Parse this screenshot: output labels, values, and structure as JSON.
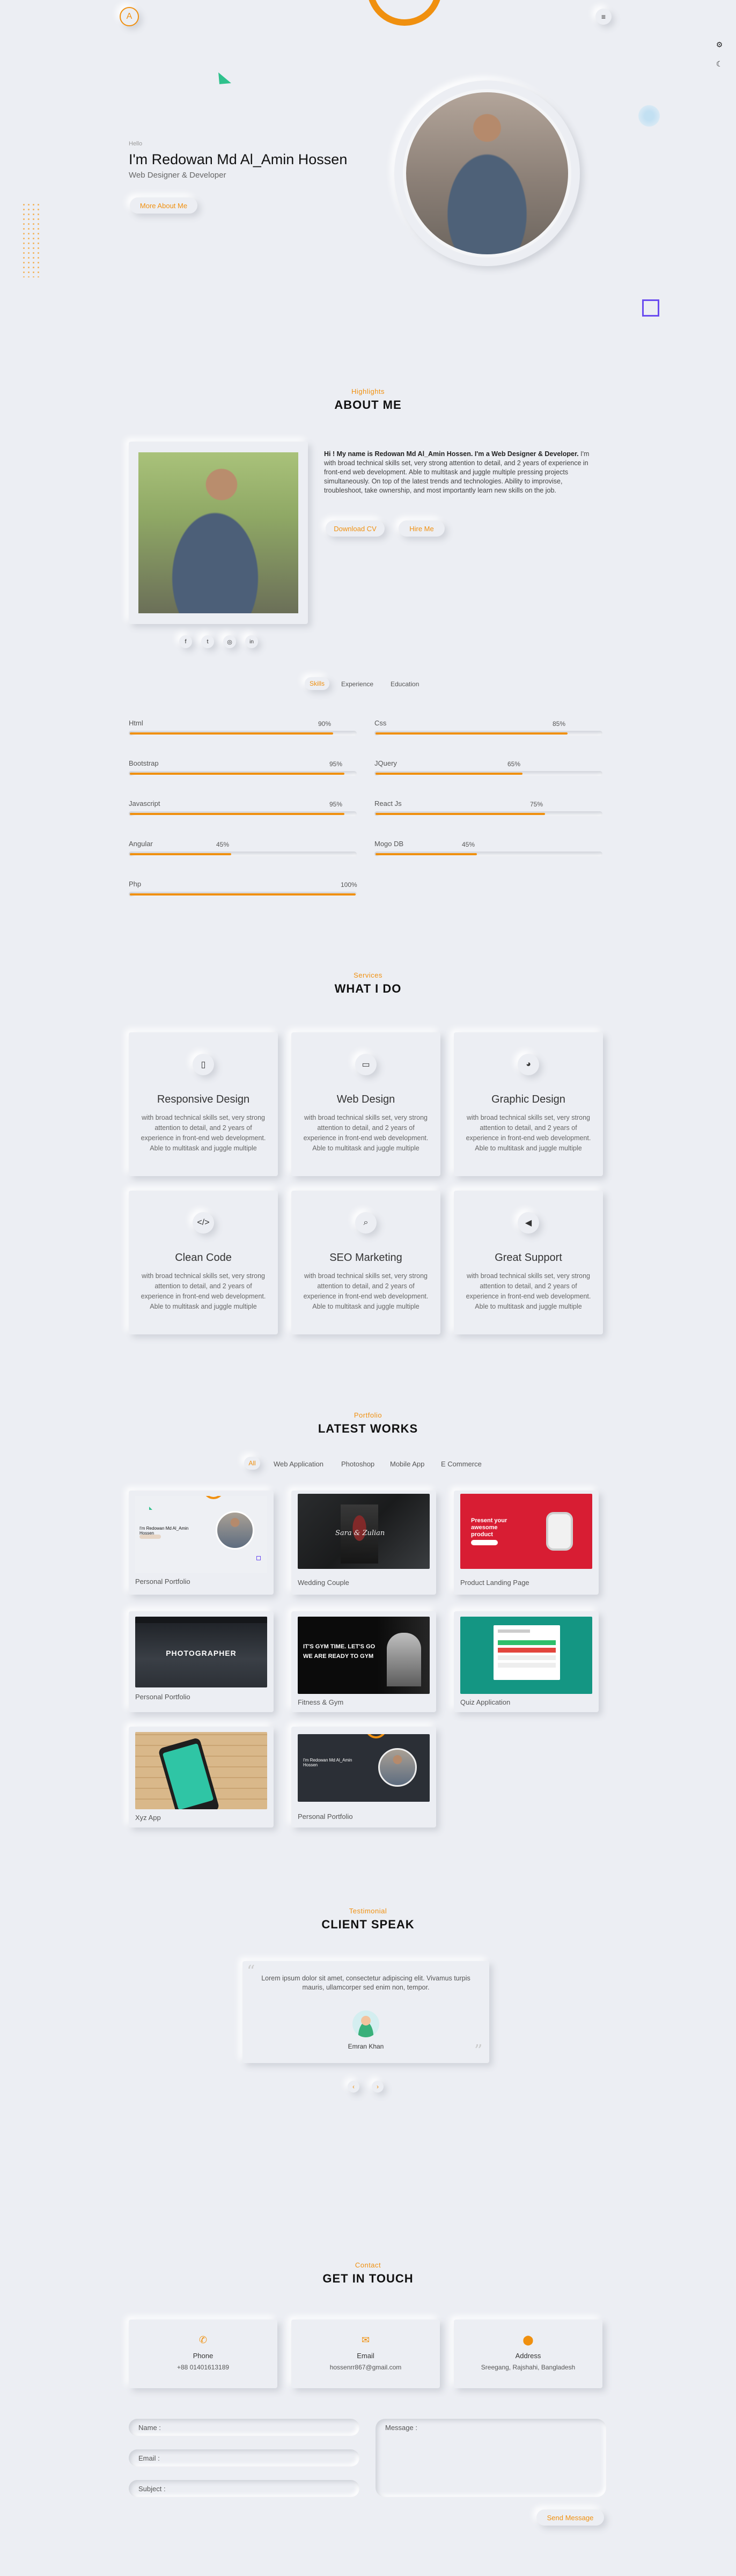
{
  "nav": {
    "logo_letter": "A"
  },
  "hero": {
    "kicker": "Hello",
    "name": "I'm Redowan Md Al_Amin Hossen",
    "role": "Web Designer & Developer",
    "button": "More About Me"
  },
  "about": {
    "kicker": "Highlights",
    "title": "ABOUT ME",
    "intro_bold": "Hi ! My name is Redowan Md Al_Amin Hossen. I'm a Web Designer & Developer.",
    "intro_rest": " I'm with broad technical skills set, very strong attention to detail, and 2 years of experience in front-end web development. Able to multitask and juggle multiple pressing projects simultaneously. On top of the latest trends and technologies. Ability to improvise, troubleshoot, take ownership, and most importantly learn new skills on the job.",
    "download_cv": "Download CV",
    "hire_me": "Hire Me",
    "socials": [
      "f",
      "t",
      "◎",
      "in"
    ],
    "tabs": [
      "Skills",
      "Experience",
      "Education"
    ],
    "skills": [
      {
        "name": "Html",
        "value": 90
      },
      {
        "name": "Css",
        "value": 85
      },
      {
        "name": "Bootstrap",
        "value": 95
      },
      {
        "name": "JQuery",
        "value": 65
      },
      {
        "name": "Javascript",
        "value": 95
      },
      {
        "name": "React Js",
        "value": 75
      },
      {
        "name": "Angular",
        "value": 45
      },
      {
        "name": "Mogo DB",
        "value": 45
      },
      {
        "name": "Php",
        "value": 100
      }
    ]
  },
  "services": {
    "kicker": "Services",
    "title": "WHAT I DO",
    "desc": "with broad technical skills set, very strong attention to detail, and 2 years of experience in front-end web development. Able to multitask and juggle multiple",
    "items": [
      {
        "title": "Responsive Design",
        "icon": "mobile-icon",
        "glyph": "▯"
      },
      {
        "title": "Web Design",
        "icon": "laptop-icon",
        "glyph": "▭"
      },
      {
        "title": "Graphic Design",
        "icon": "palette-icon",
        "glyph": "◕"
      },
      {
        "title": "Clean Code",
        "icon": "code-icon",
        "glyph": "</>"
      },
      {
        "title": "SEO Marketing",
        "icon": "search-icon",
        "glyph": "⌕"
      },
      {
        "title": "Great Support",
        "icon": "megaphone-icon",
        "glyph": "◀"
      }
    ]
  },
  "portfolio": {
    "kicker": "Portfolio",
    "title": "LATEST WORKS",
    "filters": [
      "All",
      "Web Application",
      "Photoshop",
      "Mobile App",
      "E Commerce"
    ],
    "items": [
      {
        "label": "Personal Portfolio"
      },
      {
        "label": "Wedding Couple"
      },
      {
        "label": "Product Landing Page"
      },
      {
        "label": "Personal Portfolio"
      },
      {
        "label": "Fitness & Gym"
      },
      {
        "label": "Quiz Application"
      },
      {
        "label": "Xyz App"
      },
      {
        "label": "Personal Portfolio"
      }
    ],
    "thumb_text": {
      "portfolio_name": "I'm Redowan Md Al_Amin Hossen",
      "wedding": "Sara & Zulian",
      "product": "Present your awesome product",
      "photographer": "PHOTOGRAPHER",
      "fitness_1": "IT'S GYM TIME. LET'S GO",
      "fitness_2": "WE ARE READY TO GYM"
    }
  },
  "testimonial": {
    "kicker": "Testimonial",
    "title": "CLIENT SPEAK",
    "quote": "Lorem ipsum dolor sit amet, consectetur adipiscing elit. Vivamus turpis mauris, ullamcorper sed enim non, tempor.",
    "author": "Emran Khan"
  },
  "contact": {
    "kicker": "Contact",
    "title": "GET IN TOUCH",
    "cards": [
      {
        "title": "Phone",
        "value": "+88 01401613189",
        "icon": "phone-icon",
        "glyph": "✆"
      },
      {
        "title": "Email",
        "value": "hossenrr867@gmail.com",
        "icon": "envelope-icon",
        "glyph": "✉"
      },
      {
        "title": "Address",
        "value": "Sreegang, Rajshahi, Bangladesh",
        "icon": "location-pin-icon",
        "glyph": "⬤"
      }
    ],
    "name_placeholder": "Name :",
    "email_placeholder": "Email :",
    "subject_placeholder": "Subject :",
    "message_placeholder": "Message :",
    "send": "Send Message"
  },
  "colors": {
    "accent": "#f0900f",
    "background": "#eceef3",
    "decor_green": "#2fc18c",
    "decor_purple": "#6a4cf0"
  }
}
